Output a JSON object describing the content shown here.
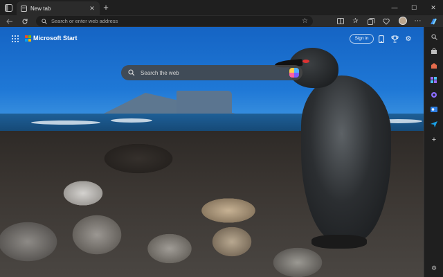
{
  "browser": {
    "tab": {
      "label": "New tab",
      "close": "✕"
    },
    "new_tab": "+",
    "window_controls": {
      "minimize": "—",
      "maximize": "☐",
      "close": "✕"
    },
    "address_bar": {
      "placeholder": "Search or enter web address"
    }
  },
  "page": {
    "brand": "Microsoft Start",
    "signin": "Sign in",
    "search": {
      "placeholder": "Search the web"
    }
  },
  "sidebar": {
    "items": [
      {
        "name": "search-icon",
        "color": "#bdbdbd"
      },
      {
        "name": "shopping-icon",
        "color": "#e56b4c"
      },
      {
        "name": "tools-icon",
        "color": "#9a6cff"
      },
      {
        "name": "games-icon",
        "color": "#8a6cff"
      },
      {
        "name": "outlook-icon",
        "color": "#2f7fe3"
      },
      {
        "name": "send-icon",
        "color": "#1aa0e6"
      }
    ],
    "add": "+"
  }
}
